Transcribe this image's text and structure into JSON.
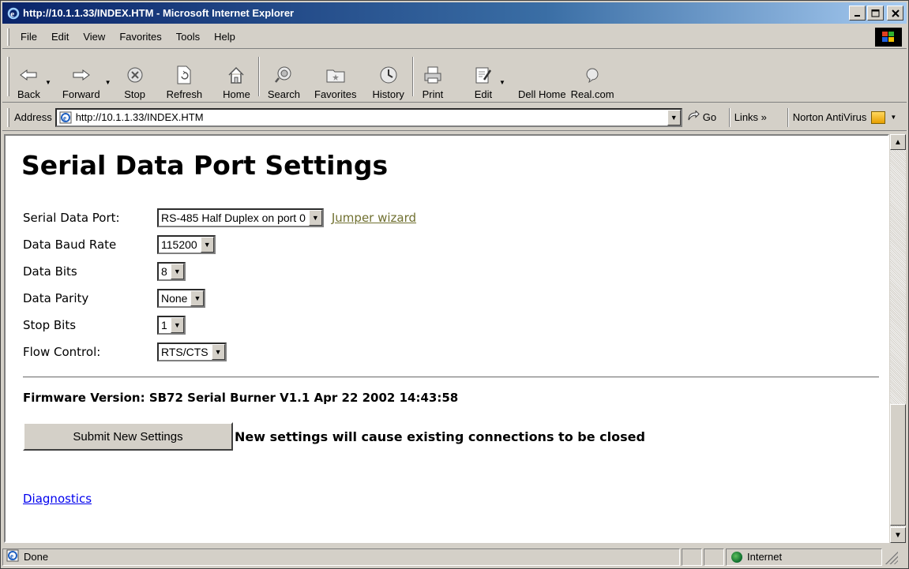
{
  "window": {
    "title": "http://10.1.1.33/INDEX.HTM - Microsoft Internet Explorer",
    "buttons": {
      "minimize": "_",
      "maximize": "□",
      "close": "✕"
    }
  },
  "menu": {
    "file": "File",
    "edit": "Edit",
    "view": "View",
    "favorites": "Favorites",
    "tools": "Tools",
    "help": "Help"
  },
  "toolbar": {
    "back": "Back",
    "forward": "Forward",
    "stop": "Stop",
    "refresh": "Refresh",
    "home": "Home",
    "search": "Search",
    "favorites": "Favorites",
    "history": "History",
    "print": "Print",
    "edit": "Edit",
    "dell_home": "Dell Home",
    "real": "Real.com"
  },
  "address": {
    "label": "Address",
    "url": "http://10.1.1.33/INDEX.HTM",
    "go": "Go",
    "links": "Links »",
    "norton": "Norton AntiVirus"
  },
  "page": {
    "heading": "Serial Data Port Settings",
    "serial_port": {
      "label": "Serial Data Port:",
      "value": "RS-485 Half Duplex on port 0"
    },
    "jumper_link": "Jumper wizard",
    "baud": {
      "label": "Data Baud Rate",
      "value": "115200"
    },
    "bits": {
      "label": "Data Bits",
      "value": "8"
    },
    "parity": {
      "label": "Data Parity",
      "value": "None"
    },
    "stop": {
      "label": "Stop Bits",
      "value": "1"
    },
    "flow": {
      "label": "Flow Control:",
      "value": "RTS/CTS"
    },
    "firmware": "Firmware Version: SB72 Serial Burner V1.1 Apr 22 2002 14:43:58",
    "submit": "Submit New Settings",
    "warning": "New settings will cause existing connections to be closed",
    "diagnostics": "Diagnostics"
  },
  "status": {
    "text": "Done",
    "zone": "Internet"
  }
}
